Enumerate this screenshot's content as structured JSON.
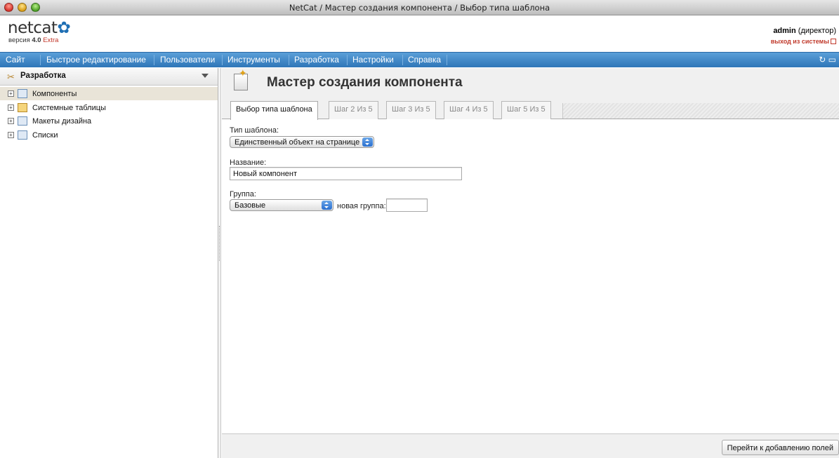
{
  "window": {
    "title": "NetCat / Мастер создания компонента / Выбор типа шаблона"
  },
  "header": {
    "logo_prefix": "netcat",
    "version_label": "версия",
    "version_number": "4.0",
    "edition": "Extra",
    "user_name": "admin",
    "user_role": "(директор)",
    "logout_label": "выход из системы"
  },
  "menu": {
    "items": [
      "Сайт",
      "Быстрое редактирование",
      "Пользователи",
      "Инструменты",
      "Разработка",
      "Настройки",
      "Справка"
    ],
    "icons": [
      "refresh-icon",
      "window-icon"
    ]
  },
  "sidebar": {
    "title": "Разработка",
    "items": [
      {
        "label": "Компоненты",
        "selected": true,
        "icon": "component-icon"
      },
      {
        "label": "Системные таблицы",
        "selected": false,
        "icon": "table-icon"
      },
      {
        "label": "Макеты дизайна",
        "selected": false,
        "icon": "layout-icon"
      },
      {
        "label": "Списки",
        "selected": false,
        "icon": "list-icon"
      }
    ]
  },
  "main": {
    "page_title": "Мастер создания компонента",
    "tabs": [
      "Выбор типа шаблона",
      "Шаг 2 Из 5",
      "Шаг 3 Из 5",
      "Шаг 4 Из 5",
      "Шаг 5 Из 5"
    ],
    "active_tab": 0,
    "form": {
      "template_type_label": "Тип шаблона:",
      "template_type_value": "Единственный объект на странице",
      "name_label": "Название:",
      "name_value": "Новый компонент",
      "group_label": "Группа:",
      "group_value": "Базовые",
      "new_group_label": "новая группа:",
      "new_group_value": ""
    },
    "next_button": "Перейти к добавлению полей"
  },
  "colors": {
    "menu_bar": "#3d86c6",
    "edition_red": "#c3382b",
    "logout_red": "#c0392b",
    "selected_row": "#e9e4d8"
  }
}
